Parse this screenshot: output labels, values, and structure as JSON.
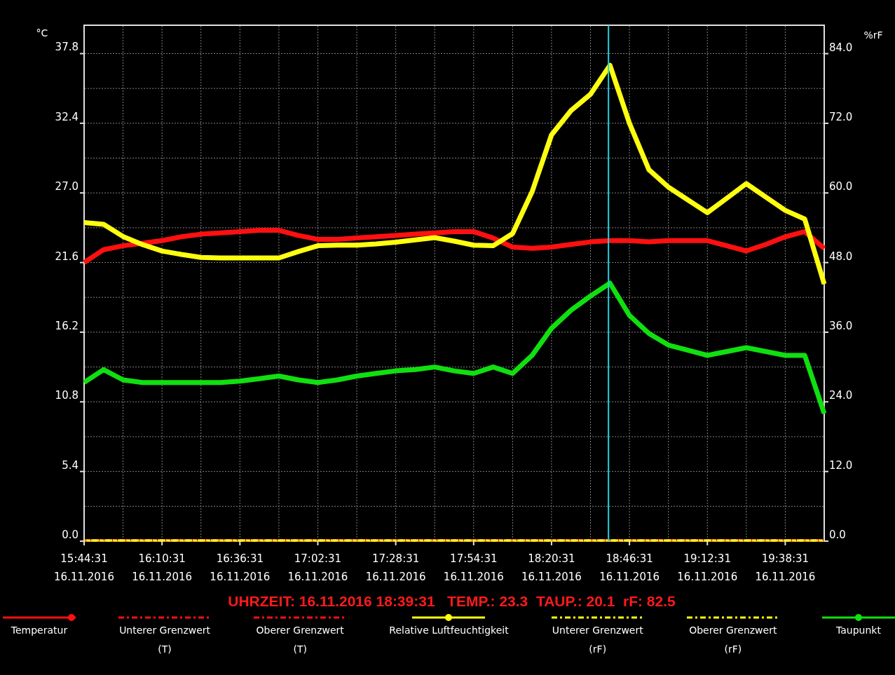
{
  "chart_data": {
    "type": "line",
    "grid": true,
    "ylabel": "°C",
    "y2label": "%rF",
    "ylim": [
      0,
      40
    ],
    "y2lim": [
      0,
      88.9
    ],
    "categories": [
      "15:44:31",
      null,
      null,
      null,
      "16:10:31",
      null,
      null,
      null,
      "16:36:31",
      null,
      null,
      null,
      "17:02:31",
      null,
      null,
      null,
      "17:28:31",
      null,
      null,
      null,
      "17:54:31",
      null,
      null,
      null,
      "18:20:31",
      null,
      null,
      null,
      "18:46:31",
      null,
      null,
      null,
      "19:12:31",
      null,
      null,
      null,
      "19:38:31",
      null,
      null
    ],
    "yticks": [
      {
        "value": 0,
        "label": "0.0"
      },
      {
        "value": 5.4,
        "label": "5.4"
      },
      {
        "value": 10.8,
        "label": "10.8"
      },
      {
        "value": 16.2,
        "label": "16.2"
      },
      {
        "value": 21.6,
        "label": "21.6"
      },
      {
        "value": 27,
        "label": "27.0"
      },
      {
        "value": 32.4,
        "label": "32.4"
      },
      {
        "value": 37.8,
        "label": "37.8"
      }
    ],
    "y2ticks": [
      {
        "value": 0,
        "label": "0.0"
      },
      {
        "value": 12,
        "label": "12.0"
      },
      {
        "value": 24,
        "label": "24.0"
      },
      {
        "value": 36,
        "label": "36.0"
      },
      {
        "value": 48,
        "label": "48.0"
      },
      {
        "value": 60,
        "label": "60.0"
      },
      {
        "value": 72,
        "label": "72.0"
      },
      {
        "value": 84,
        "label": "84.0"
      }
    ],
    "series": [
      {
        "name": "Temperatur",
        "color": "#ff1010",
        "values": [
          21.6,
          22.6,
          22.9,
          23.1,
          23.3,
          23.6,
          23.8,
          23.9,
          24.0,
          24.1,
          24.1,
          23.7,
          23.4,
          23.4,
          23.5,
          23.6,
          23.7,
          23.8,
          23.9,
          24.0,
          24.0,
          23.5,
          22.8,
          22.7,
          22.8,
          23.0,
          23.2,
          23.3,
          23.3,
          23.2,
          23.3,
          23.3,
          23.3,
          22.9,
          22.5,
          23.0,
          23.6,
          24.0,
          22.7
        ]
      },
      {
        "name": "Relative Luftfeuchtigkeit",
        "color": "#ffff10",
        "axis": "y2",
        "values": [
          54.9,
          54.6,
          52.5,
          51.1,
          50.0,
          49.4,
          48.9,
          48.8,
          48.8,
          48.8,
          48.8,
          49.9,
          50.9,
          51.0,
          51.0,
          51.2,
          51.5,
          51.9,
          52.3,
          51.7,
          51.0,
          50.9,
          53.0,
          60.2,
          70.0,
          74.2,
          77.0,
          82.0,
          72.0,
          64.0,
          61.0,
          58.8,
          56.6,
          59.1,
          61.6,
          59.3,
          57.0,
          55.5,
          44.3
        ]
      },
      {
        "name": "Taupunkt",
        "color": "#10e010",
        "values": [
          12.3,
          13.3,
          12.5,
          12.3,
          12.3,
          12.3,
          12.3,
          12.3,
          12.4,
          12.6,
          12.8,
          12.5,
          12.3,
          12.5,
          12.8,
          13.0,
          13.2,
          13.3,
          13.5,
          13.2,
          13.0,
          13.5,
          13.0,
          14.4,
          16.5,
          17.9,
          19.0,
          20.0,
          17.5,
          16.1,
          15.2,
          14.8,
          14.4,
          14.7,
          15.0,
          14.7,
          14.4,
          14.4,
          9.9
        ]
      }
    ]
  },
  "x_dates": [
    "16.11.2016",
    "16.11.2016",
    "16.11.2016",
    "16.11.2016",
    "16.11.2016",
    "16.11.2016",
    "16.11.2016",
    "16.11.2016",
    "16.11.2016",
    "16.11.2016"
  ],
  "cursor": {
    "level": 0.7085
  },
  "readout": "UHRZEIT: 16.11.2016 18:39:31   TEMP.: 23.3  TAUP.: 20.1  rF: 82.5",
  "legend": [
    {
      "kind": "series"
    },
    {
      "kind": "limit",
      "label": "Unterer Grenzwert",
      "qualifier": "(T)",
      "color": "#ff1010"
    },
    {
      "kind": "limit",
      "label": "Oberer Grenzwert",
      "qualifier": "(T)",
      "color": "#ff1010"
    },
    {
      "kind": "series"
    },
    {
      "kind": "limit",
      "label": "Unterer Grenzwert",
      "qualifier": "(rF)",
      "color": "#ffff10"
    },
    {
      "kind": "limit",
      "label": "Oberer Grenzwert",
      "qualifier": "(rF)",
      "color": "#ffff10"
    },
    {
      "kind": "series"
    }
  ]
}
